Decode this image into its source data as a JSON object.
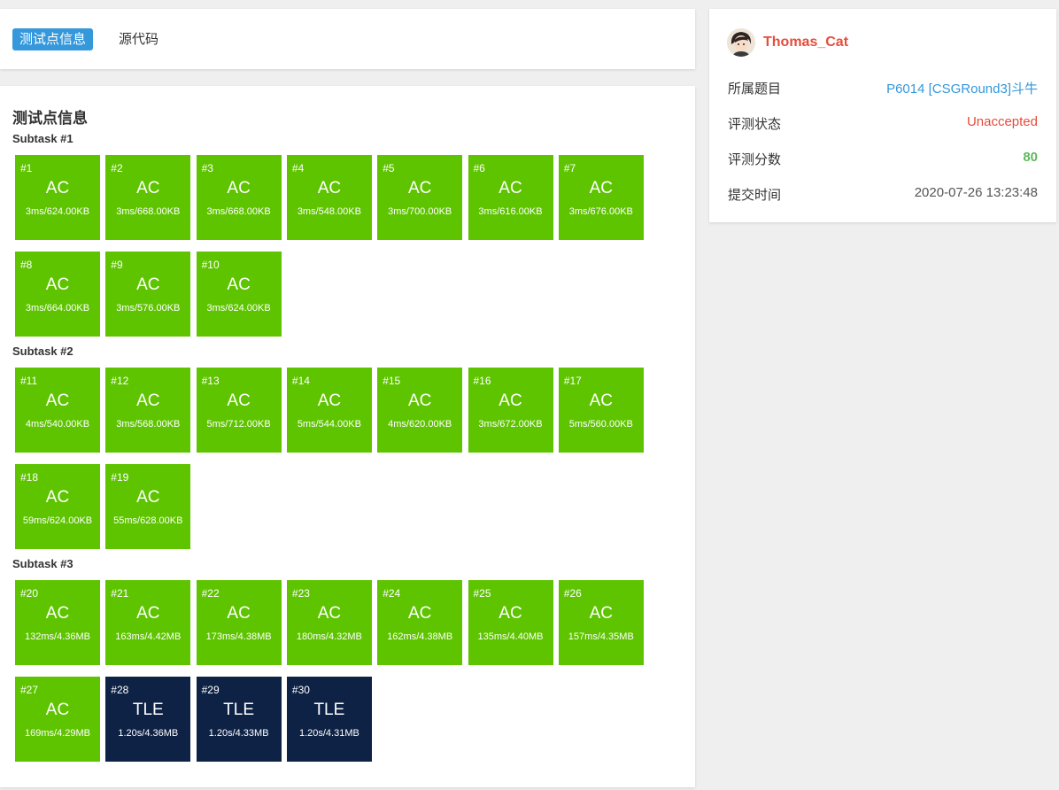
{
  "tabs": [
    {
      "label": "测试点信息",
      "active": true
    },
    {
      "label": "源代码",
      "active": false
    }
  ],
  "main": {
    "title": "测试点信息",
    "subtasks": [
      {
        "label": "Subtask #1",
        "cases": [
          {
            "id": "#1",
            "status": "AC",
            "info": "3ms/624.00KB"
          },
          {
            "id": "#2",
            "status": "AC",
            "info": "3ms/668.00KB"
          },
          {
            "id": "#3",
            "status": "AC",
            "info": "3ms/668.00KB"
          },
          {
            "id": "#4",
            "status": "AC",
            "info": "3ms/548.00KB"
          },
          {
            "id": "#5",
            "status": "AC",
            "info": "3ms/700.00KB"
          },
          {
            "id": "#6",
            "status": "AC",
            "info": "3ms/616.00KB"
          },
          {
            "id": "#7",
            "status": "AC",
            "info": "3ms/676.00KB"
          },
          {
            "id": "#8",
            "status": "AC",
            "info": "3ms/664.00KB"
          },
          {
            "id": "#9",
            "status": "AC",
            "info": "3ms/576.00KB"
          },
          {
            "id": "#10",
            "status": "AC",
            "info": "3ms/624.00KB"
          }
        ]
      },
      {
        "label": "Subtask #2",
        "cases": [
          {
            "id": "#11",
            "status": "AC",
            "info": "4ms/540.00KB"
          },
          {
            "id": "#12",
            "status": "AC",
            "info": "3ms/568.00KB"
          },
          {
            "id": "#13",
            "status": "AC",
            "info": "5ms/712.00KB"
          },
          {
            "id": "#14",
            "status": "AC",
            "info": "5ms/544.00KB"
          },
          {
            "id": "#15",
            "status": "AC",
            "info": "4ms/620.00KB"
          },
          {
            "id": "#16",
            "status": "AC",
            "info": "3ms/672.00KB"
          },
          {
            "id": "#17",
            "status": "AC",
            "info": "5ms/560.00KB"
          },
          {
            "id": "#18",
            "status": "AC",
            "info": "59ms/624.00KB"
          },
          {
            "id": "#19",
            "status": "AC",
            "info": "55ms/628.00KB"
          }
        ]
      },
      {
        "label": "Subtask #3",
        "cases": [
          {
            "id": "#20",
            "status": "AC",
            "info": "132ms/4.36MB"
          },
          {
            "id": "#21",
            "status": "AC",
            "info": "163ms/4.42MB"
          },
          {
            "id": "#22",
            "status": "AC",
            "info": "173ms/4.38MB"
          },
          {
            "id": "#23",
            "status": "AC",
            "info": "180ms/4.32MB"
          },
          {
            "id": "#24",
            "status": "AC",
            "info": "162ms/4.38MB"
          },
          {
            "id": "#25",
            "status": "AC",
            "info": "135ms/4.40MB"
          },
          {
            "id": "#26",
            "status": "AC",
            "info": "157ms/4.35MB"
          },
          {
            "id": "#27",
            "status": "AC",
            "info": "169ms/4.29MB"
          },
          {
            "id": "#28",
            "status": "TLE",
            "info": "1.20s/4.36MB"
          },
          {
            "id": "#29",
            "status": "TLE",
            "info": "1.20s/4.33MB"
          },
          {
            "id": "#30",
            "status": "TLE",
            "info": "1.20s/4.31MB"
          }
        ]
      }
    ]
  },
  "side": {
    "username": "Thomas_Cat",
    "rows": [
      {
        "key": "所属题目",
        "value": "P6014 [CSGRound3]斗牛"
      },
      {
        "key": "评测状态",
        "value": "Unaccepted"
      },
      {
        "key": "评测分数",
        "value": "80"
      },
      {
        "key": "提交时间",
        "value": "2020-07-26 13:23:48"
      }
    ]
  },
  "colors": {
    "ac": "#5ec400",
    "tle": "#0e2245",
    "accent": "#3498db",
    "username": "#e74c3c",
    "score": "#5eb95e"
  }
}
